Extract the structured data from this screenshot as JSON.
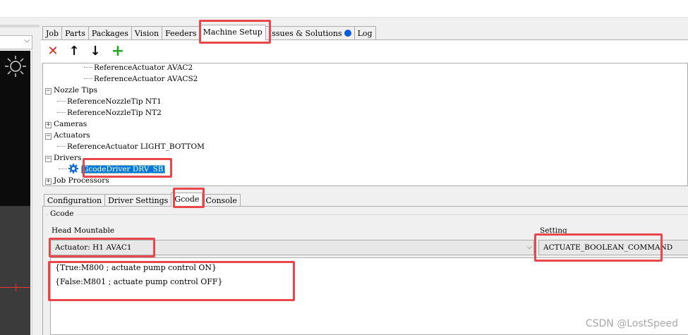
{
  "main_tabs": [
    {
      "label": "Job"
    },
    {
      "label": "Parts"
    },
    {
      "label": "Packages"
    },
    {
      "label": "Vision"
    },
    {
      "label": "Feeders"
    },
    {
      "label": "Machine Setup"
    },
    {
      "label": "Issues & Solutions"
    },
    {
      "label": "Log"
    }
  ],
  "active_main_tab": "Machine Setup",
  "toolbar": {
    "delete_glyph": "✕",
    "up_glyph": "↑",
    "down_glyph": "↓",
    "add_glyph": "+"
  },
  "tree": [
    {
      "label": "ReferenceActuator AVAC2"
    },
    {
      "label": "ReferenceActuator AVACS2"
    },
    {
      "label": "Nozzle Tips",
      "expander": "−"
    },
    {
      "label": "ReferenceNozzleTip NT1"
    },
    {
      "label": "ReferenceNozzleTip NT2"
    },
    {
      "label": "Cameras",
      "expander": "+"
    },
    {
      "label": "Actuators",
      "expander": "−"
    },
    {
      "label": "ReferenceActuator LIGHT_BOTTOM"
    },
    {
      "label": "Drivers",
      "expander": "−"
    },
    {
      "label": "GcodeDriver DRV_SB",
      "selected": true,
      "icon": "gear-icon"
    },
    {
      "label": "Job Processors",
      "expander": "+"
    }
  ],
  "sub_tabs": [
    {
      "label": "Configuration"
    },
    {
      "label": "Driver Settings"
    },
    {
      "label": "Gcode"
    },
    {
      "label": "Console"
    }
  ],
  "active_sub_tab": "Gcode",
  "gcode_panel": {
    "group_title": "Gcode",
    "head_mountable_label": "Head Mountable",
    "head_mountable_value": "Actuator: H1 AVAC1",
    "setting_label": "Setting",
    "setting_value": "ACTUATE_BOOLEAN_COMMAND",
    "lines": [
      "{True:M800 ; actuate pump control ON}",
      "{False:M801 ; actuate pump control OFF}"
    ]
  },
  "watermark": "CSDN @LostSpeed",
  "highlight_color": "#e8484b",
  "selection_color": "#0078d7",
  "icons": [
    "delete-icon",
    "arrow-up-icon",
    "arrow-down-icon",
    "add-icon",
    "gear-icon",
    "sun-icon",
    "chevron-down-icon"
  ]
}
